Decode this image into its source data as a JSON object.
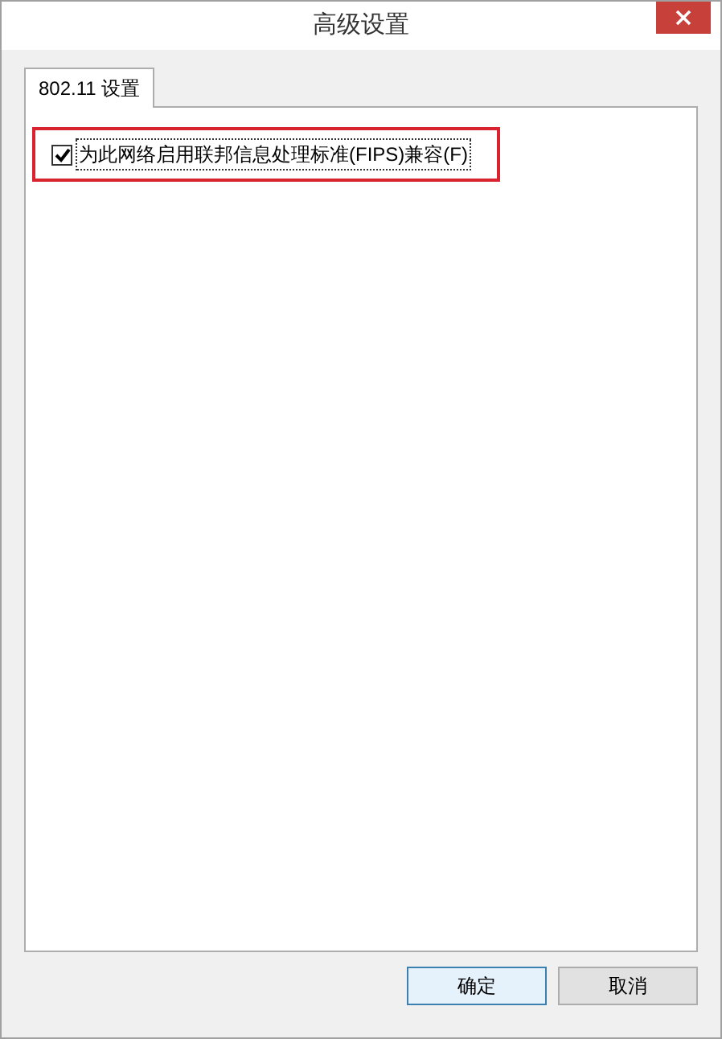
{
  "window": {
    "title": "高级设置"
  },
  "tabs": [
    {
      "label": "802.11 设置",
      "selected": true
    }
  ],
  "options": [
    {
      "label": "为此网络启用联邦信息处理标准(FIPS)兼容(F)",
      "checked": true,
      "highlighted": true
    }
  ],
  "buttons": [
    {
      "label": "确定",
      "default": true
    },
    {
      "label": "取消",
      "default": false
    }
  ]
}
